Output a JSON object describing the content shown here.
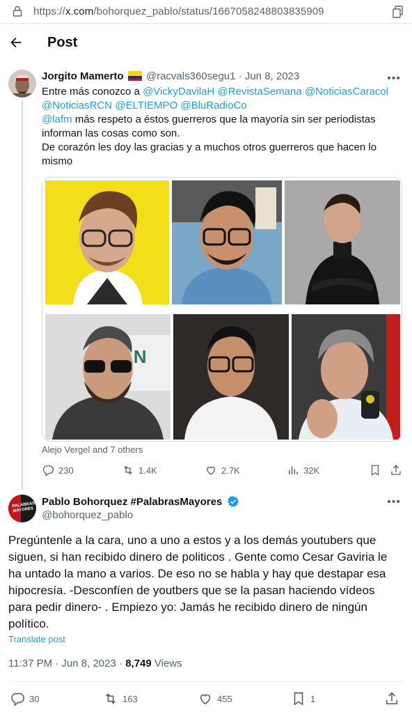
{
  "browser": {
    "url_prefix": "https://",
    "url_host": "x.com",
    "url_path": "/bohorquez_pablo/status/1667058248803835909"
  },
  "header": {
    "title": "Post"
  },
  "quoted": {
    "name": "Jorgito Mamerto",
    "handle": "@racvals360segu1",
    "sep": "·",
    "date": "Jun 8, 2023",
    "line1_text": "Entre más conozco a ",
    "mentions1": "@VickyDavilaH @RevistaSemana @NoticiasCaracol",
    "mentions2": "@NoticiasRCN @ELTIEMPO @BluRadioCo",
    "mention3": "@lafm",
    "line3_text": "  más respeto a éstos guerreros que la mayoría sin ser periodistas",
    "line4": "informan las cosas como son.",
    "line5": "De corazón les doy las gracias y a muchos otros guerreros que hacen lo",
    "line6": "mismo",
    "tagged": "Alejo Vergel and 7 others",
    "replies": "230",
    "reposts": "1.4K",
    "likes": "2.7K",
    "views": "32K"
  },
  "main": {
    "name": "Pablo Bohorquez #PalabrasMayores",
    "handle": "@bohorquez_pablo",
    "avatar_text": "PALABRAS MAYORES",
    "lines": [
      "Pregúntenle a la cara, uno a uno a estos y a los demás youtubers que",
      "siguen, si han recibido dinero de politicos . Gente como Cesar Gaviria le",
      "ha untado la mano a varios. De eso no se habla y hay que destapar esa",
      "hipocresía. -Desconfíen de youtbers que se la pasan haciendo vídeos",
      "para pedir dinero- . Empiezo yo: Jamás he recibido dinero de ningún",
      "político."
    ],
    "translate": "Translate post",
    "time": "11:37 PM",
    "sep": "·",
    "date": "Jun 8, 2023",
    "views_count": "8,749",
    "views_label": "Views",
    "replies": "30",
    "reposts": "163",
    "likes": "455",
    "bookmarks": "1"
  },
  "colors": {
    "accent": "#1d9bf0",
    "muted": "#536471",
    "text": "#0f1419",
    "border": "#cfd9de"
  },
  "icons": [
    "lock-icon",
    "back-arrow-icon",
    "more-icon",
    "reply-icon",
    "repost-icon",
    "like-icon",
    "views-icon",
    "bookmark-icon",
    "share-icon",
    "verified-icon",
    "flag-icon"
  ]
}
